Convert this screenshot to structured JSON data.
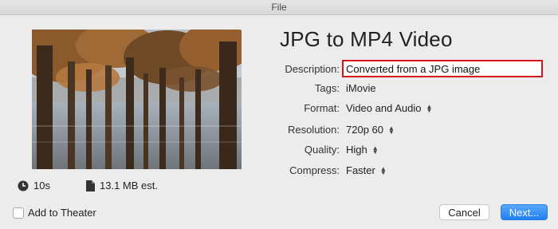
{
  "window": {
    "title": "File"
  },
  "project": {
    "title": "JPG to MP4 Video"
  },
  "fields": {
    "description": {
      "label": "Description:",
      "value": "Converted from a JPG image"
    },
    "tags": {
      "label": "Tags:",
      "value": "iMovie"
    },
    "format": {
      "label": "Format:",
      "value": "Video and Audio"
    },
    "resolution": {
      "label": "Resolution:",
      "value": "720p 60"
    },
    "quality": {
      "label": "Quality:",
      "value": "High"
    },
    "compress": {
      "label": "Compress:",
      "value": "Faster"
    }
  },
  "meta": {
    "duration": "10s",
    "size": "13.1 MB est."
  },
  "options": {
    "add_to_theater_label": "Add to Theater",
    "add_to_theater_checked": false
  },
  "buttons": {
    "cancel": "Cancel",
    "next": "Next..."
  },
  "icons": {
    "duration": "clock-icon",
    "size": "document-icon",
    "stepper": "up-down-arrows-icon"
  },
  "colors": {
    "highlight_box": "#d4141e",
    "primary_button": "#1f7ff2"
  }
}
